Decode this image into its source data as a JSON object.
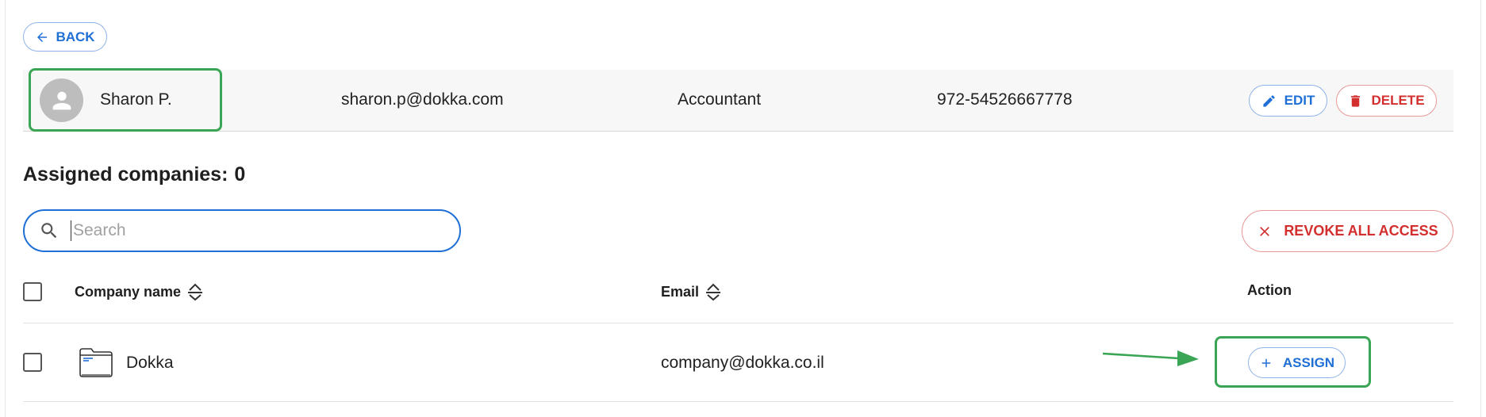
{
  "nav": {
    "back_label": "BACK"
  },
  "user": {
    "name": "Sharon P.",
    "email": "sharon.p@dokka.com",
    "role": "Accountant",
    "phone": "972-54526667778",
    "edit_label": "EDIT",
    "delete_label": "DELETE"
  },
  "assigned": {
    "label": "Assigned companies:",
    "count": "0"
  },
  "search": {
    "placeholder": "Search",
    "value": ""
  },
  "revoke_label": "REVOKE ALL ACCESS",
  "table": {
    "columns": [
      "Company name",
      "Email",
      "Action"
    ],
    "rows": [
      {
        "name": "Dokka",
        "email": "company@dokka.co.il",
        "action_label": "ASSIGN"
      }
    ]
  },
  "colors": {
    "primary": "#1f6fd6",
    "danger": "#d32f2f",
    "highlight": "#3aa655"
  },
  "icons": [
    "arrow-left-icon",
    "user-avatar-icon",
    "pencil-icon",
    "trash-icon",
    "search-icon",
    "close-icon",
    "sort-icon",
    "folder-icon",
    "plus-icon",
    "annotation-arrow"
  ]
}
